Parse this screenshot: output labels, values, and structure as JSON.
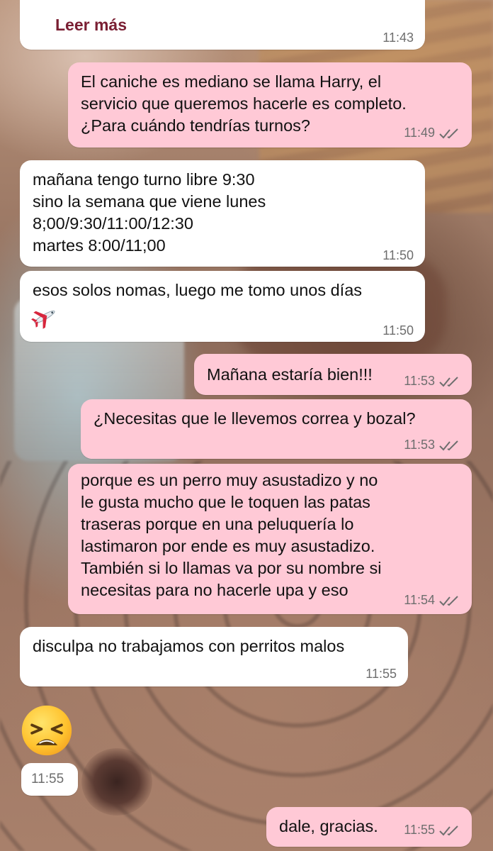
{
  "messages": [
    {
      "id": "m0",
      "direction": "in",
      "read_more": "Leer más",
      "time": "11:43"
    },
    {
      "id": "m1",
      "direction": "out",
      "text": "El caniche es mediano se llama Harry, el\nservicio que queremos hacerle es completo.\n¿Para cuándo tendrías turnos?",
      "time": "11:49"
    },
    {
      "id": "m2",
      "direction": "in",
      "text": "mañana tengo turno libre  9:30\nsino la semana que viene lunes\n8;00/9:30/11:00/12:30\nmartes 8:00/11;00",
      "time": "11:50"
    },
    {
      "id": "m3",
      "direction": "in",
      "text": "esos solos nomas, luego me tomo unos días",
      "emoji": "✈️",
      "time": "11:50"
    },
    {
      "id": "m4",
      "direction": "out",
      "text": "Mañana estaría bien!!!",
      "time": "11:53"
    },
    {
      "id": "m5",
      "direction": "out",
      "text": "¿Necesitas que le llevemos correa y bozal?",
      "time": "11:53"
    },
    {
      "id": "m6",
      "direction": "out",
      "text": "porque es un perro muy asustadizo y no\nle gusta mucho que le toquen las patas\ntraseras porque en una peluquería lo\nlastimaron por ende es muy asustadizo.\nTambién si lo llamas va por su nombre si\nnecesitas para no hacerle upa y eso",
      "time": "11:54"
    },
    {
      "id": "m7",
      "direction": "in",
      "text": "disculpa no trabajamos con perritos malos",
      "time": "11:55"
    },
    {
      "id": "m8",
      "direction": "in",
      "sticker": "persevering-face-emoji",
      "time": "11:55"
    },
    {
      "id": "m9",
      "direction": "out",
      "text": "dale, gracias.",
      "time": "11:55"
    }
  ],
  "colors": {
    "incoming_bubble": "#ffffff",
    "outgoing_bubble": "#ffc9d6",
    "read_ticks": "#6e6e6e",
    "read_more": "#7a1f33"
  }
}
